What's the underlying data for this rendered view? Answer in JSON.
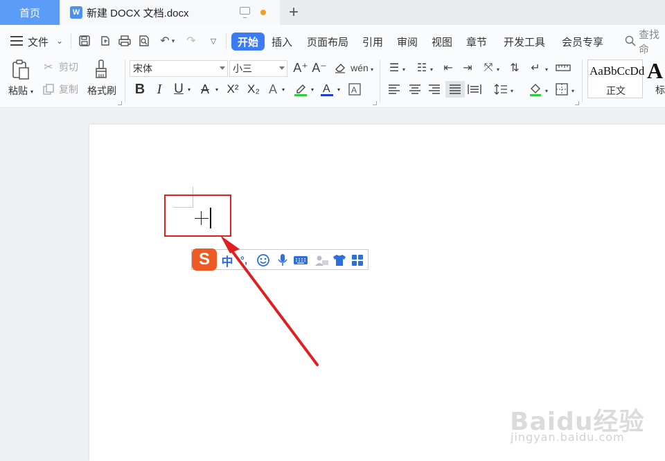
{
  "tabs": {
    "home_label": "首页",
    "doc_label": "新建 DOCX 文档.docx",
    "doc_icon_letter": "W",
    "add_label": "+"
  },
  "menu": {
    "file_label": "文件",
    "active_tab": "开始",
    "items": [
      "插入",
      "页面布局",
      "引用",
      "审阅",
      "视图",
      "章节",
      "开发工具",
      "会员专享"
    ],
    "search_label": "查找命"
  },
  "ribbon": {
    "paste_label": "粘贴",
    "cut_label": "剪切",
    "copy_label": "复制",
    "format_painter_label": "格式刷",
    "font_name": "宋体",
    "font_size": "小三",
    "style_sample": "AaBbCcDd",
    "style_normal_label": "正文",
    "style_heading_sample": "A",
    "style_heading_label": "标"
  },
  "ime": {
    "logo": "S",
    "mode": "中",
    "punct": "°,"
  },
  "colors": {
    "accent": "#3b7bf4",
    "home_tab": "#5a9cf8",
    "highlight_box": "#e02020",
    "arrow": "#e02020",
    "ime_logo": "#ee5a24"
  },
  "watermark": {
    "logo": "Baidu经验",
    "url": "jingyan.baidu.com"
  }
}
